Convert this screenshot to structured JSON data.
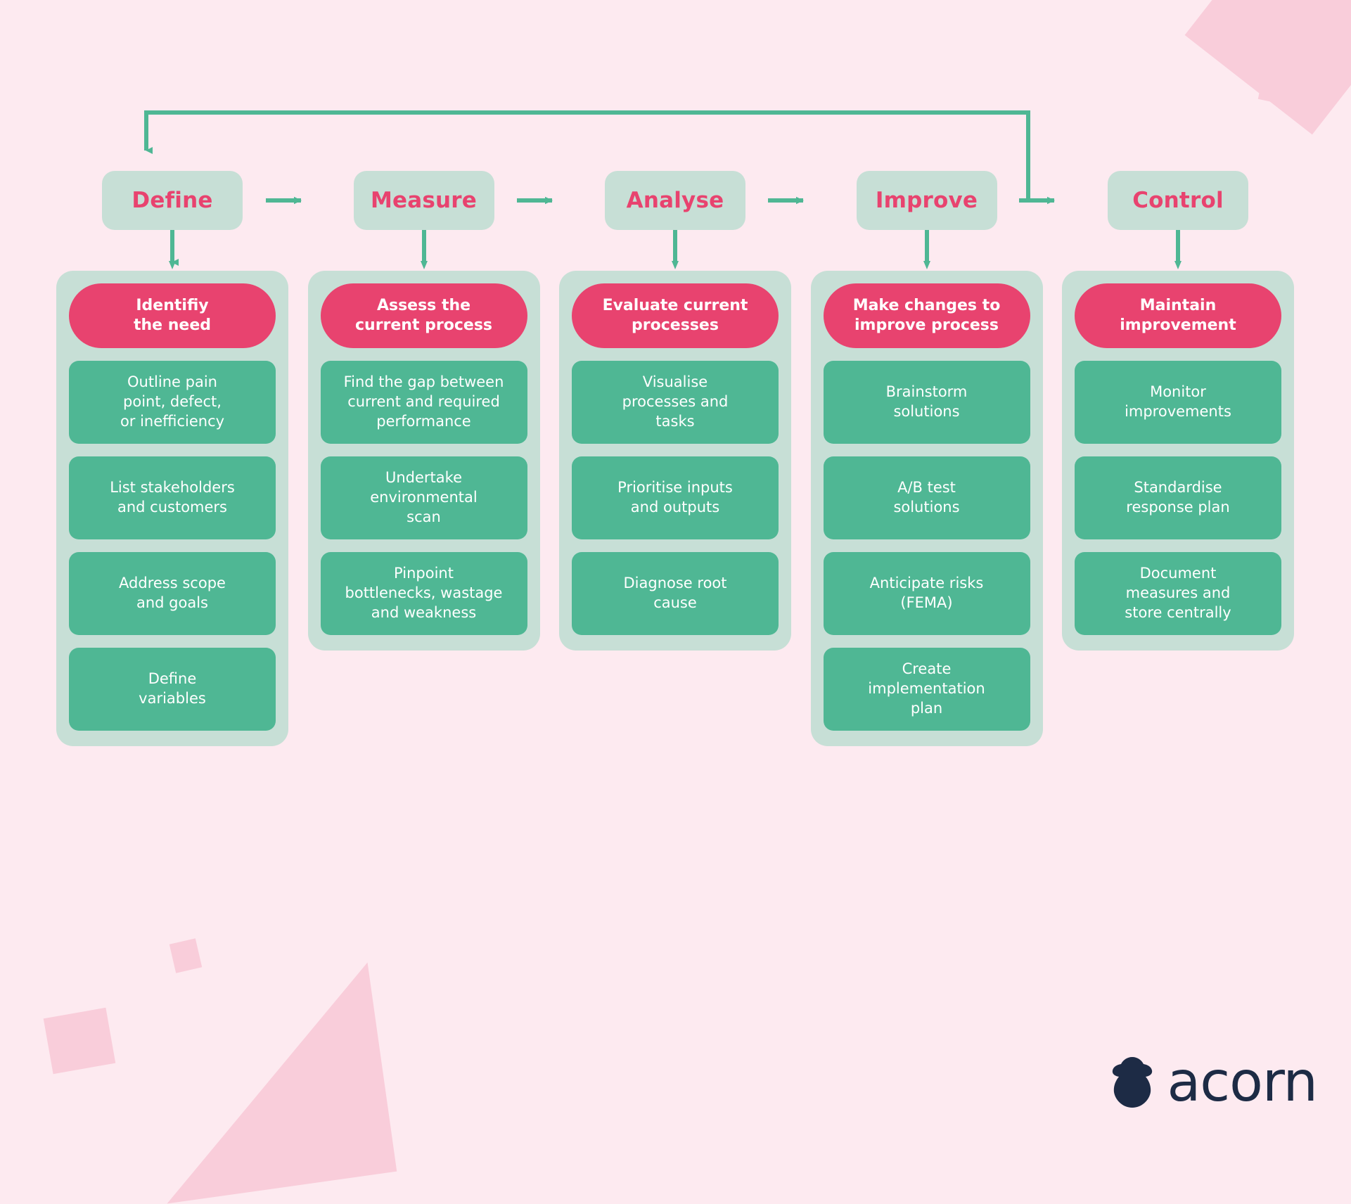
{
  "theme": {
    "background": "#fdeaf0",
    "panel_green": "#c7dfd6",
    "item_green": "#4fb794",
    "accent_pink": "#e8436f",
    "arrow_green": "#4fb794",
    "deco_pink": "#f9cdda",
    "logo_navy": "#1d2b45",
    "text_white": "#ffffff"
  },
  "diagram": {
    "type": "dmaic-process-flow",
    "loop": "Control feeds back to Define",
    "stages": [
      {
        "name": "Define",
        "goal": "Identifiy\nthe need",
        "goal_lines": [
          "Identifiy",
          "the need"
        ],
        "items": [
          "Outline pain\npoint, defect,\nor inefficiency",
          "List stakeholders\nand customers",
          "Address scope\nand goals",
          "Define\nvariables"
        ],
        "item_lines": [
          [
            "Outline pain",
            "point, defect,",
            "or inefficiency"
          ],
          [
            "List stakeholders",
            "and customers"
          ],
          [
            "Address scope",
            "and goals"
          ],
          [
            "Define",
            "variables"
          ]
        ]
      },
      {
        "name": "Measure",
        "goal": "Assess the\ncurrent process",
        "goal_lines": [
          "Assess the",
          "current process"
        ],
        "items": [
          "Find the gap between\ncurrent and required\nperformance",
          "Undertake\nenvironmental\nscan",
          "Pinpoint\nbottlenecks, wastage\nand weakness"
        ],
        "item_lines": [
          [
            "Find the gap between",
            "current and required",
            "performance"
          ],
          [
            "Undertake",
            "environmental",
            "scan"
          ],
          [
            "Pinpoint",
            "bottlenecks, wastage",
            "and weakness"
          ]
        ]
      },
      {
        "name": "Analyse",
        "goal": "Evaluate current\nprocesses",
        "goal_lines": [
          "Evaluate current",
          "processes"
        ],
        "items": [
          "Visualise\nprocesses and\ntasks",
          "Prioritise inputs\nand outputs",
          "Diagnose root\ncause"
        ],
        "item_lines": [
          [
            "Visualise",
            "processes and",
            "tasks"
          ],
          [
            "Prioritise inputs",
            "and outputs"
          ],
          [
            "Diagnose root",
            "cause"
          ]
        ]
      },
      {
        "name": "Improve",
        "goal": "Make changes to\nimprove process",
        "goal_lines": [
          "Make changes to",
          "improve process"
        ],
        "items": [
          "Brainstorm\nsolutions",
          "A/B test\nsolutions",
          "Anticipate risks\n(FEMA)",
          "Create\nimplementation\nplan"
        ],
        "item_lines": [
          [
            "Brainstorm",
            "solutions"
          ],
          [
            "A/B test",
            "solutions"
          ],
          [
            "Anticipate risks",
            "(FEMA)"
          ],
          [
            "Create",
            "implementation",
            "plan"
          ]
        ]
      },
      {
        "name": "Control",
        "goal": "Maintain\nimprovement",
        "goal_lines": [
          "Maintain",
          "improvement"
        ],
        "items": [
          "Monitor\nimprovements",
          "Standardise\nresponse plan",
          "Document\nmeasures and\nstore centrally"
        ],
        "item_lines": [
          [
            "Monitor",
            "improvements"
          ],
          [
            "Standardise",
            "response plan"
          ],
          [
            "Document",
            "measures and",
            "store centrally"
          ]
        ]
      }
    ]
  },
  "branding": {
    "logo_text": "acorn",
    "logo_mark": "acorn-icon"
  }
}
